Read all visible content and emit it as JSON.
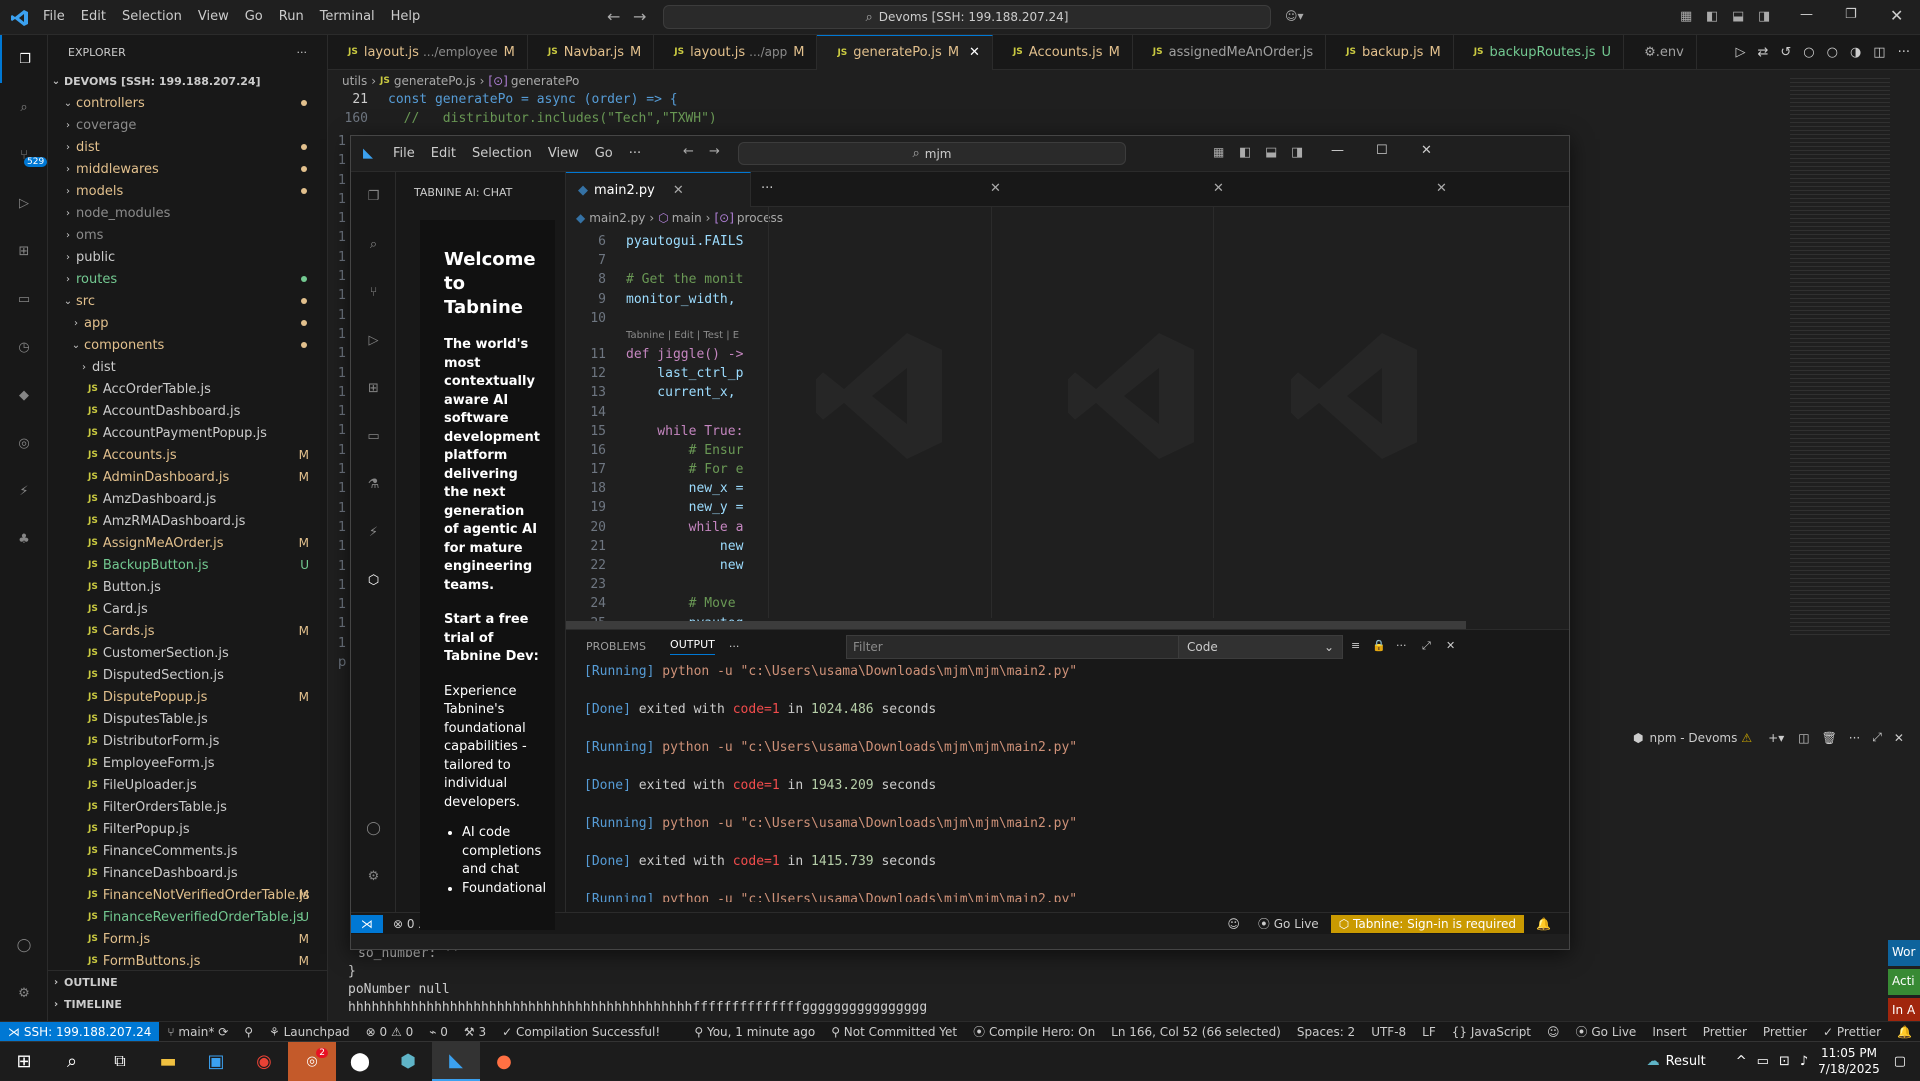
{
  "menu": [
    "File",
    "Edit",
    "Selection",
    "View",
    "Go",
    "Run",
    "Terminal",
    "Help"
  ],
  "search": "Devoms [SSH: 199.188.207.24]",
  "explorer": {
    "title": "EXPLORER",
    "root": "DEVOMS [SSH: 199.188.207.24]",
    "folders": [
      "controllers",
      "coverage",
      "dist",
      "middlewares",
      "models",
      "node_modules",
      "oms",
      "public",
      "routes",
      "src",
      "app",
      "components",
      "dist"
    ],
    "files": [
      {
        "name": "AccOrderTable.js",
        "badge": ""
      },
      {
        "name": "AccountDashboard.js",
        "badge": ""
      },
      {
        "name": "AccountPaymentPopup.js",
        "badge": ""
      },
      {
        "name": "Accounts.js",
        "badge": "M"
      },
      {
        "name": "AdminDashboard.js",
        "badge": "M"
      },
      {
        "name": "AmzDashboard.js",
        "badge": ""
      },
      {
        "name": "AmzRMADashboard.js",
        "badge": ""
      },
      {
        "name": "AssignMeAOrder.js",
        "badge": "M"
      },
      {
        "name": "BackupButton.js",
        "badge": "U"
      },
      {
        "name": "Button.js",
        "badge": ""
      },
      {
        "name": "Card.js",
        "badge": ""
      },
      {
        "name": "Cards.js",
        "badge": "M"
      },
      {
        "name": "CustomerSection.js",
        "badge": ""
      },
      {
        "name": "DisputedSection.js",
        "badge": ""
      },
      {
        "name": "DisputePopup.js",
        "badge": "M"
      },
      {
        "name": "DisputesTable.js",
        "badge": ""
      },
      {
        "name": "DistributorForm.js",
        "badge": ""
      },
      {
        "name": "EmployeeForm.js",
        "badge": ""
      },
      {
        "name": "FileUploader.js",
        "badge": ""
      },
      {
        "name": "FilterOrdersTable.js",
        "badge": ""
      },
      {
        "name": "FilterPopup.js",
        "badge": ""
      },
      {
        "name": "FinanceComments.js",
        "badge": ""
      },
      {
        "name": "FinanceDashboard.js",
        "badge": ""
      },
      {
        "name": "FinanceNotVerifiedOrderTable.js",
        "badge": "M"
      },
      {
        "name": "FinanceReverifiedOrderTable.js",
        "badge": "U"
      },
      {
        "name": "Form.js",
        "badge": "M"
      },
      {
        "name": "FormButtons.js",
        "badge": "M"
      }
    ],
    "outline": "OUTLINE",
    "timeline": "TIMELINE"
  },
  "tabs": [
    {
      "label": "layout.js",
      "desc": ".../employee",
      "badge": "M"
    },
    {
      "label": "Navbar.js",
      "desc": "",
      "badge": "M"
    },
    {
      "label": "layout.js",
      "desc": ".../app",
      "badge": "M"
    },
    {
      "label": "generatePo.js",
      "desc": "",
      "badge": "M"
    },
    {
      "label": "Accounts.js",
      "desc": "",
      "badge": "M"
    },
    {
      "label": "assignedMeAnOrder.js",
      "desc": "",
      "badge": ""
    },
    {
      "label": "backup.js",
      "desc": "",
      "badge": "M"
    },
    {
      "label": "backupRoutes.js",
      "desc": "",
      "badge": "U"
    },
    {
      "label": ".env",
      "desc": "",
      "badge": ""
    }
  ],
  "breadcrumb": [
    "utils",
    "generatePo.js",
    "generatePo"
  ],
  "outer_code": {
    "l21": "21",
    "l160": "160",
    "code21": "const generatePo = async (order) => {",
    "code160": "  //   distributor.includes(\"Tech\",\"TXWH\")",
    "tail1": "so_number: ''",
    "tail2": "}",
    "tail3": "poNumber null",
    "tail4": "hhhhhhhhhhhhhhhhhhhhhhhhhhhhhhhhhhhhhhhhhhhhffffffffffffffgggggggggggggggg"
  },
  "inner": {
    "menu": [
      "File",
      "Edit",
      "Selection",
      "View",
      "Go"
    ],
    "search": "mjm",
    "panel_title": "TABNINE AI: CHAT",
    "tab": "main2.py",
    "crumbs": [
      "main2.py",
      "main",
      "process"
    ],
    "lens": "Tabnine | Edit | Test | E",
    "code": [
      {
        "n": "6",
        "t": "pyautogui.FAILS"
      },
      {
        "n": "7",
        "t": ""
      },
      {
        "n": "8",
        "t": "# Get the monit"
      },
      {
        "n": "9",
        "t": "monitor_width,"
      },
      {
        "n": "10",
        "t": ""
      },
      {
        "n": "11",
        "t": "def jiggle() ->"
      },
      {
        "n": "12",
        "t": "    last_ctrl_p"
      },
      {
        "n": "13",
        "t": "    current_x,"
      },
      {
        "n": "14",
        "t": ""
      },
      {
        "n": "15",
        "t": "    while True:"
      },
      {
        "n": "16",
        "t": "        # Ensur"
      },
      {
        "n": "17",
        "t": "        # For e"
      },
      {
        "n": "18",
        "t": "        new_x ="
      },
      {
        "n": "19",
        "t": "        new_y ="
      },
      {
        "n": "20",
        "t": "        while a"
      },
      {
        "n": "21",
        "t": "            new"
      },
      {
        "n": "22",
        "t": "            new"
      },
      {
        "n": "23",
        "t": ""
      },
      {
        "n": "24",
        "t": "        # Move"
      },
      {
        "n": "25",
        "t": "        pyautog"
      }
    ],
    "tabnine": {
      "welcome": "Welcome to Tabnine",
      "tagline": "The world's most contextually aware AI software development platform delivering the next generation of agentic AI for mature engineering teams.",
      "trial": "Start a free trial of Tabnine Dev:",
      "exp": "Experience Tabnine's foundational capabilities - tailored to individual developers.",
      "b1": "AI code completions and chat",
      "b2": "Foundational"
    },
    "panel_tabs": [
      "PROBLEMS",
      "OUTPUT"
    ],
    "filter_ph": "Filter",
    "channel": "Code",
    "output": [
      {
        "kind": "running",
        "a": "[Running]",
        "b": " python -u \"c:\\Users\\usama\\Downloads\\mjm\\mjm\\main2.py\""
      },
      {
        "kind": "done",
        "a": "[Done]",
        "b": " exited with ",
        "c": "code=1",
        "d": " in ",
        "e": "1024.486",
        "f": " seconds"
      },
      {
        "kind": "running",
        "a": "[Running]",
        "b": " python -u \"c:\\Users\\usama\\Downloads\\mjm\\mjm\\main2.py\""
      },
      {
        "kind": "done",
        "a": "[Done]",
        "b": " exited with ",
        "c": "code=1",
        "d": " in ",
        "e": "1943.209",
        "f": " seconds"
      },
      {
        "kind": "running",
        "a": "[Running]",
        "b": " python -u \"c:\\Users\\usama\\Downloads\\mjm\\mjm\\main2.py\""
      },
      {
        "kind": "done",
        "a": "[Done]",
        "b": " exited with ",
        "c": "code=1",
        "d": " in ",
        "e": "1415.739",
        "f": " seconds"
      },
      {
        "kind": "running",
        "a": "[Running]",
        "b": " python -u \"c:\\Users\\usama\\Downloads\\mjm\\mjm\\main2.py\""
      }
    ],
    "status": {
      "errors": "0",
      "warnings": "0",
      "golive": "Go Live",
      "tabnine": "Tabnine: Sign-in is required"
    }
  },
  "terminal_label": "npm - Devoms",
  "status": {
    "ssh": "SSH: 199.188.207.24",
    "branch": "main*",
    "launchpad": "Launchpad",
    "errors": "0",
    "warnings": "0",
    "ports": "0",
    "ext": "3",
    "compile": "Compilation Successful!",
    "blame": "You, 1 minute ago",
    "commit": "Not Committed Yet",
    "hero": "Compile Hero: On",
    "pos": "Ln 166, Col 52 (66 selected)",
    "spaces": "Spaces: 2",
    "enc": "UTF-8",
    "eol": "LF",
    "lang": "JavaScript",
    "golive": "Go Live",
    "insert": "Insert",
    "prettier1": "Prettier",
    "prettier2": "Prettier",
    "prettier3": "Prettier"
  },
  "side_notices": [
    "Wor",
    "Acti",
    "In A"
  ],
  "taskbar": {
    "weather": "Result",
    "time": "11:05 PM",
    "date": "7/18/2025",
    "zoom_badge": "2"
  },
  "scm_count": "529",
  "colors": {
    "accent": "#0078d4",
    "modified": "#e2c08d",
    "untracked": "#73c991",
    "tabnine_warn": "#ca9a01"
  }
}
